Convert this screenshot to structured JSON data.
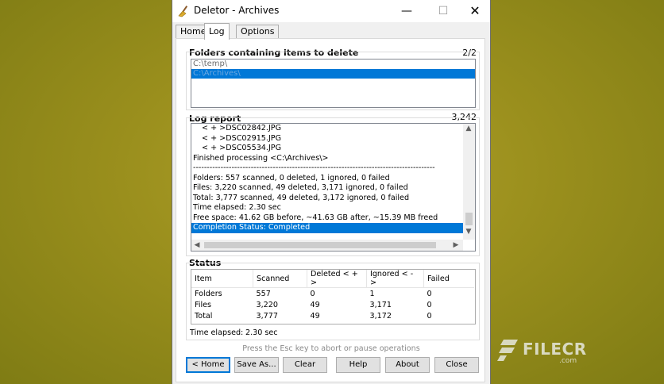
{
  "window": {
    "title": "Deletor - Archives",
    "minimize_glyph": "—",
    "maximize_glyph": "☐",
    "close_glyph": "✕"
  },
  "tabs": [
    {
      "label": "Home",
      "active": false
    },
    {
      "label": "Log",
      "active": true
    },
    {
      "label": "Options",
      "active": false
    }
  ],
  "folders": {
    "title": "Folders containing items to delete",
    "count": "2/2",
    "items": [
      {
        "text": "C:\\temp\\",
        "selected": false
      },
      {
        "text": "C:\\Archives\\",
        "selected": true
      }
    ]
  },
  "log": {
    "title": "Log report",
    "count": "3,242",
    "lines": [
      {
        "text": "< + >DSC02842.JPG",
        "indent": true,
        "selected": false
      },
      {
        "text": "< + >DSC02915.JPG",
        "indent": true,
        "selected": false
      },
      {
        "text": "< + >DSC05534.JPG",
        "indent": true,
        "selected": false
      },
      {
        "text": "Finished processing <C:\\Archives\\>",
        "indent": false,
        "selected": false
      },
      {
        "text": "----------------------------------------------------------------------------------------",
        "indent": false,
        "selected": false
      },
      {
        "text": "Folders: 557 scanned, 0 deleted, 1 ignored, 0 failed",
        "indent": false,
        "selected": false
      },
      {
        "text": "Files: 3,220 scanned, 49 deleted, 3,171 ignored, 0 failed",
        "indent": false,
        "selected": false
      },
      {
        "text": "Total: 3,777 scanned, 49 deleted, 3,172 ignored, 0 failed",
        "indent": false,
        "selected": false
      },
      {
        "text": "Time elapsed: 2.30 sec",
        "indent": false,
        "selected": false
      },
      {
        "text": "Free space: 41.62 GB before, ~41.63 GB after, ~15.39 MB freed",
        "indent": false,
        "selected": false
      },
      {
        "text": "Completion Status: Completed",
        "indent": false,
        "selected": true
      }
    ]
  },
  "status": {
    "title": "Status",
    "headers": [
      "Item",
      "Scanned",
      "Deleted < + >",
      "Ignored < - >",
      "Failed"
    ],
    "rows": [
      [
        "Folders",
        "557",
        "0",
        "1",
        "0"
      ],
      [
        "Files",
        "3,220",
        "49",
        "3,171",
        "0"
      ],
      [
        "Total",
        "3,777",
        "49",
        "3,172",
        "0"
      ]
    ],
    "time_label": "Time elapsed:",
    "time_value": "2.30 sec"
  },
  "hint": "Press the Esc key to abort or pause operations",
  "buttons": {
    "home": "< Home",
    "save_as": "Save As...",
    "clear": "Clear",
    "help": "Help",
    "about": "About",
    "close": "Close"
  },
  "watermark": {
    "brand": "FILECR",
    "suffix": ".com"
  },
  "colors": {
    "selection": "#0078d7",
    "default_button_border": "#0078d7"
  }
}
